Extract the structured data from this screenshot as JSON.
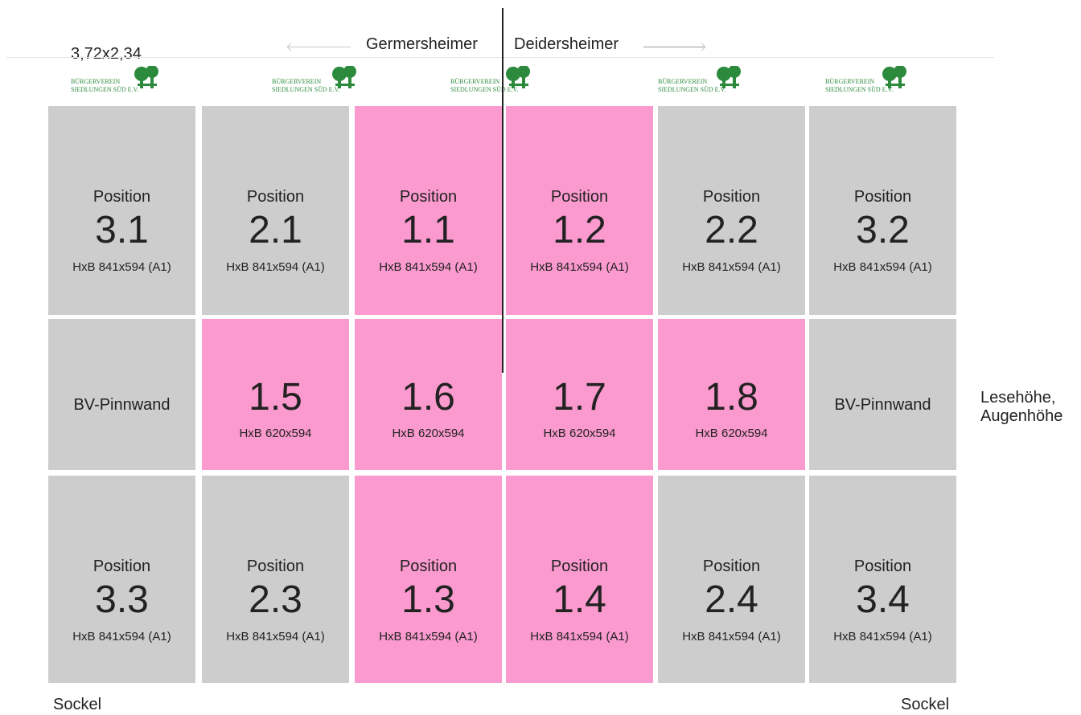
{
  "header": {
    "dimensions": "3,72x2,34",
    "street_left": "Germersheimer",
    "street_right": "Deidersheimer"
  },
  "logos": [
    {
      "line1": "BÜRGERVEREIN",
      "line2": "SIEDLUNGEN SÜD E.V."
    },
    {
      "line1": "BÜRGERVEREIN",
      "line2": "SIEDLUNGEN SÜD E.V."
    },
    {
      "line1": "BÜRGERVEREIN",
      "line2": "SIEDLUNGEN SÜD E.V."
    },
    {
      "line1": "BÜRGERVEREIN",
      "line2": "SIEDLUNGEN SÜD E.V."
    },
    {
      "line1": "BÜRGERVEREIN",
      "line2": "SIEDLUNGEN SÜD E.V."
    }
  ],
  "rows": {
    "top": [
      {
        "label": "Position",
        "number": "3.1",
        "size": "HxB  841x594 (A1)",
        "color": "gray"
      },
      {
        "label": "Position",
        "number": "2.1",
        "size": "HxB  841x594 (A1)",
        "color": "gray"
      },
      {
        "label": "Position",
        "number": "1.1",
        "size": "HxB  841x594 (A1)",
        "color": "pink"
      },
      {
        "label": "Position",
        "number": "1.2",
        "size": "HxB  841x594 (A1)",
        "color": "pink"
      },
      {
        "label": "Position",
        "number": "2.2",
        "size": "HxB  841x594 (A1)",
        "color": "gray"
      },
      {
        "label": "Position",
        "number": "3.2",
        "size": "HxB  841x594 (A1)",
        "color": "gray"
      }
    ],
    "middle": [
      {
        "label": "BV-Pinnwand",
        "color": "gray"
      },
      {
        "number": "1.5",
        "size": "HxB  620x594",
        "color": "pink"
      },
      {
        "number": "1.6",
        "size": "HxB  620x594",
        "color": "pink"
      },
      {
        "number": "1.7",
        "size": "HxB  620x594",
        "color": "pink"
      },
      {
        "number": "1.8",
        "size": "HxB  620x594",
        "color": "pink"
      },
      {
        "label": "BV-Pinnwand",
        "color": "gray"
      }
    ],
    "bottom": [
      {
        "label": "Position",
        "number": "3.3",
        "size": "HxB  841x594 (A1)",
        "color": "gray"
      },
      {
        "label": "Position",
        "number": "2.3",
        "size": "HxB  841x594 (A1)",
        "color": "gray"
      },
      {
        "label": "Position",
        "number": "1.3",
        "size": "HxB  841x594 (A1)",
        "color": "pink"
      },
      {
        "label": "Position",
        "number": "1.4",
        "size": "HxB  841x594 (A1)",
        "color": "pink"
      },
      {
        "label": "Position",
        "number": "2.4",
        "size": "HxB  841x594 (A1)",
        "color": "gray"
      },
      {
        "label": "Position",
        "number": "3.4",
        "size": "HxB  841x594 (A1)",
        "color": "gray"
      }
    ]
  },
  "side_labels": {
    "line1": "Lesehöhe,",
    "line2": "Augenhöhe"
  },
  "footer": {
    "left": "Sockel",
    "right": "Sockel"
  },
  "colors": {
    "gray": "#cdcdcd",
    "pink": "#fb9ace",
    "logo_green": "#2c8a3c"
  }
}
